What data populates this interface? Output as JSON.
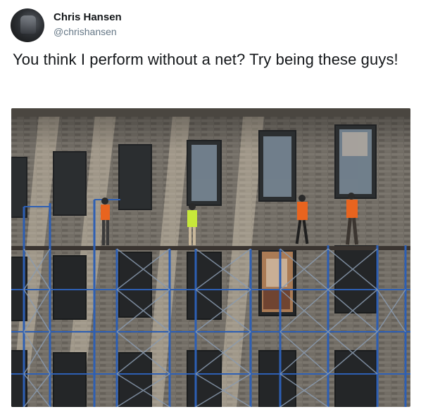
{
  "tweet": {
    "display_name": "Chris Hansen",
    "handle": "@chrishansen",
    "text": "You think I perform without a net? Try being these guys!"
  },
  "photo": {
    "subject": "construction workers on scaffolding along a brick building facade",
    "colors": {
      "brick": "#6f6a63",
      "window_frame": "#2b2e30",
      "scaffold": "#2d5fb4",
      "safety_vest": "#e8641f",
      "hi_vis": "#c7e83a"
    }
  }
}
